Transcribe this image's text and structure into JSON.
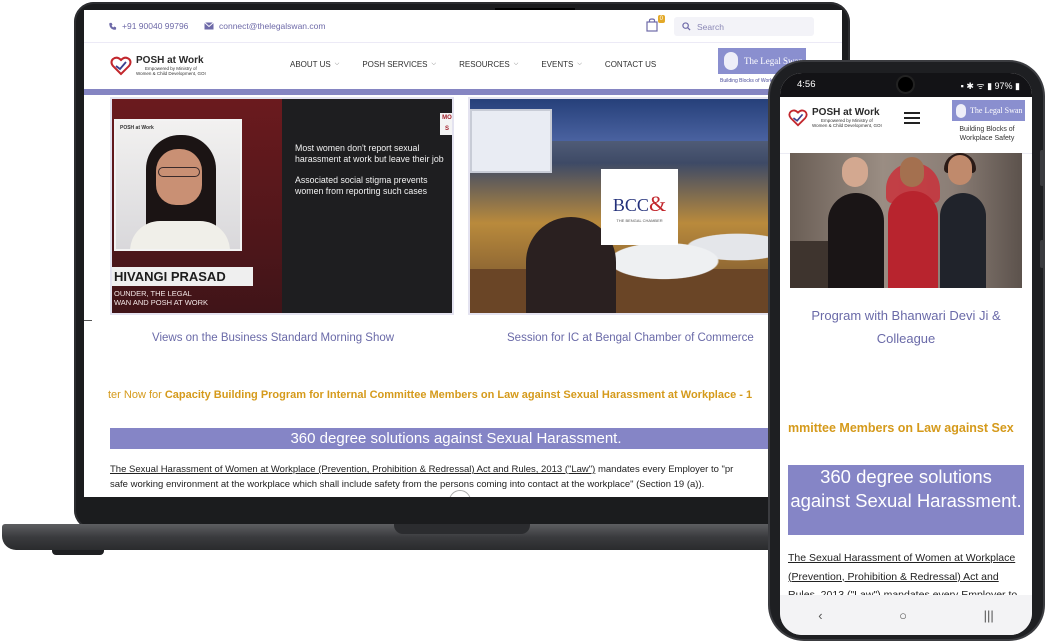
{
  "laptop": {
    "topbar": {
      "phone": "+91 90040 99796",
      "email": "connect@thelegalswan.com",
      "cart_count": "0",
      "search_placeholder": "Search"
    },
    "logo": {
      "title": "POSH at Work",
      "subtitle_1": "Empowered by Ministry of",
      "subtitle_2": "Women & Child Development, GOI"
    },
    "nav": [
      {
        "label": "ABOUT US",
        "has_menu": true
      },
      {
        "label": "POSH SERVICES",
        "has_menu": true
      },
      {
        "label": "RESOURCES",
        "has_menu": true
      },
      {
        "label": "EVENTS",
        "has_menu": true
      },
      {
        "label": "CONTACT US",
        "has_menu": false
      }
    ],
    "brand_badge": "The Legal Swan",
    "brand_tagline": "Building Blocks of Workplace Safety",
    "card_video": {
      "mini_logo": "POSH at Work",
      "chip": "MO S",
      "text_1": "Most women don't report sexual harassment at work but leave their job",
      "text_2": "Associated social stigma prevents women from reporting such cases",
      "name": "HIVANGI PRASAD",
      "role_1": "OUNDER, THE LEGAL",
      "role_2": "WAN AND POSH AT WORK",
      "caption": "Views on the Business Standard Morning Show"
    },
    "card_event": {
      "logo_text": "BCC",
      "logo_amp": "&",
      "logo_sub": "THE BENGAL CHAMBER",
      "caption": "Session for IC at Bengal Chamber of Commerce"
    },
    "marquee_prefix": "ter Now for ",
    "marquee_bold": "Capacity Building Program for Internal Committee Members on Law against Sexual Harassment at Workplace - 1",
    "band": "360 degree solutions against Sexual Harassment.",
    "law_link": "The Sexual Harassment of Women at Workplace (Prevention, Prohibition & Redressal) Act and Rules, 2013 (\"Law\")",
    "law_rest": " mandates every Employer to \"pr",
    "law_line2": "safe working environment at the workplace which shall include safety from the persons coming into contact at the workplace\" (Section 19 (a))."
  },
  "phone": {
    "status_time": "4:56",
    "status_right": "97%",
    "logo_title": "POSH at Work",
    "logo_subtitle_1": "Empowered by Ministry of",
    "logo_subtitle_2": "Women & Child Development, GOI",
    "brand_badge": "The Legal Swan",
    "brand_tagline": "Building Blocks of Workplace Safety",
    "caption": "Program with Bhanwari Devi Ji & Colleague",
    "marquee": "mmittee Members on Law against Sex",
    "band": "360 degree solutions against Sexual Harassment.",
    "law_text": "The Sexual Harassment of Women at Workplace (Prevention, Prohibition & Redressal) Act and Rules, 2013 (\"Law\") mandates every Employer to",
    "nav_back": "‹",
    "nav_home": "○",
    "nav_recent": "|||"
  },
  "colors": {
    "accent": "#8585c6",
    "gold": "#d59a1b",
    "caption": "#6a6aa8"
  }
}
